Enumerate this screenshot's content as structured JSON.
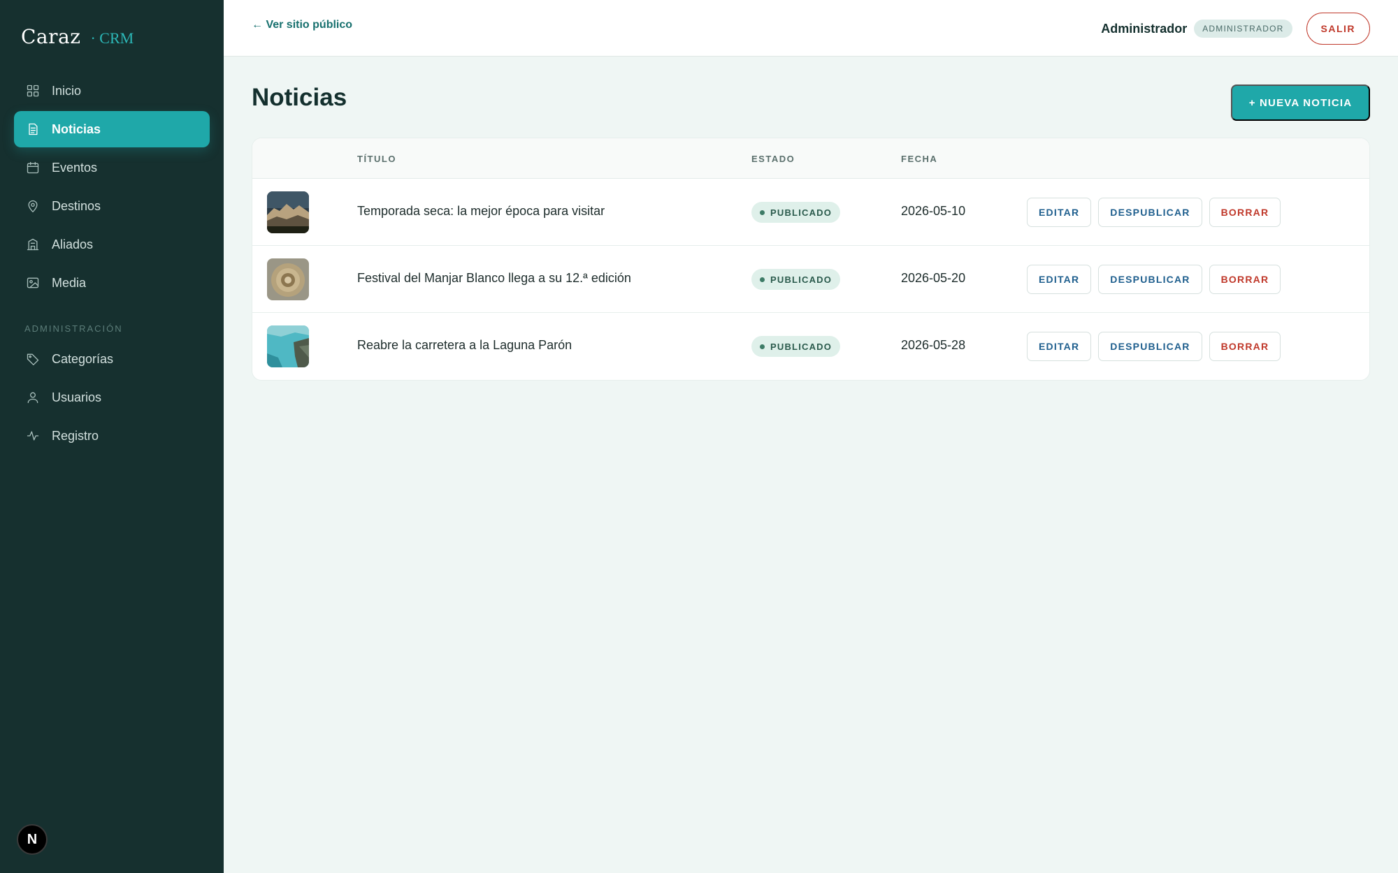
{
  "brand": {
    "name": "Caraz",
    "suffix": "· CRM"
  },
  "sidebar": {
    "items": [
      {
        "label": "Inicio",
        "icon": "grid-icon",
        "active": false
      },
      {
        "label": "Noticias",
        "icon": "document-icon",
        "active": true
      },
      {
        "label": "Eventos",
        "icon": "calendar-icon",
        "active": false
      },
      {
        "label": "Destinos",
        "icon": "map-pin-icon",
        "active": false
      },
      {
        "label": "Aliados",
        "icon": "building-icon",
        "active": false
      },
      {
        "label": "Media",
        "icon": "image-icon",
        "active": false
      }
    ],
    "section_label": "ADMINISTRACIÓN",
    "admin_items": [
      {
        "label": "Categorías",
        "icon": "tag-icon"
      },
      {
        "label": "Usuarios",
        "icon": "user-icon"
      },
      {
        "label": "Registro",
        "icon": "activity-icon"
      }
    ],
    "badge_letter": "N"
  },
  "header": {
    "back_link": "← Ver sitio público",
    "user_name": "Administrador",
    "role": "ADMINISTRADOR",
    "logout": "SALIR"
  },
  "main": {
    "title": "Noticias",
    "new_button": "+ NUEVA NOTICIA",
    "columns": {
      "title": "TÍTULO",
      "status": "ESTADO",
      "date": "FECHA"
    },
    "rows": [
      {
        "title": "Temporada seca: la mejor época para visitar",
        "status": "PUBLICADO",
        "date": "2026-05-10",
        "edit": "EDITAR",
        "unpublish": "DESPUBLICAR",
        "delete": "BORRAR"
      },
      {
        "title": "Festival del Manjar Blanco llega a su 12.ª edición",
        "status": "PUBLICADO",
        "date": "2026-05-20",
        "edit": "EDITAR",
        "unpublish": "DESPUBLICAR",
        "delete": "BORRAR"
      },
      {
        "title": "Reabre la carretera a la Laguna Parón",
        "status": "PUBLICADO",
        "date": "2026-05-28",
        "edit": "EDITAR",
        "unpublish": "DESPUBLICAR",
        "delete": "BORRAR"
      }
    ]
  },
  "colors": {
    "sidebar": "#16302f",
    "accent": "#1fa8a9",
    "danger": "#c0392b",
    "link_blue": "#1f5f8e"
  }
}
